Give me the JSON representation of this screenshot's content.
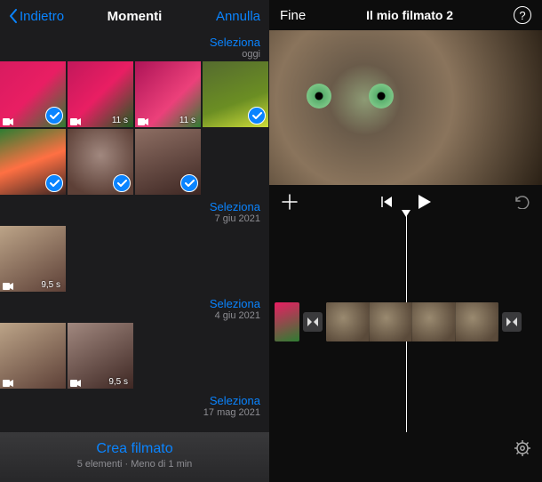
{
  "left": {
    "back_label": "Indietro",
    "title": "Momenti",
    "cancel_label": "Annulla",
    "select_label": "Seleziona",
    "sections": [
      {
        "date": "oggi"
      },
      {
        "date": "7 giu 2021"
      },
      {
        "date": "4 giu 2021"
      },
      {
        "date": "17 mag 2021"
      }
    ],
    "durations": {
      "d11s": "11 s",
      "d95s": "9,5 s"
    },
    "create_title": "Crea filmato",
    "create_sub": "5 elementi · Meno di 1 min"
  },
  "right": {
    "done_label": "Fine",
    "title": "Il mio filmato 2"
  }
}
